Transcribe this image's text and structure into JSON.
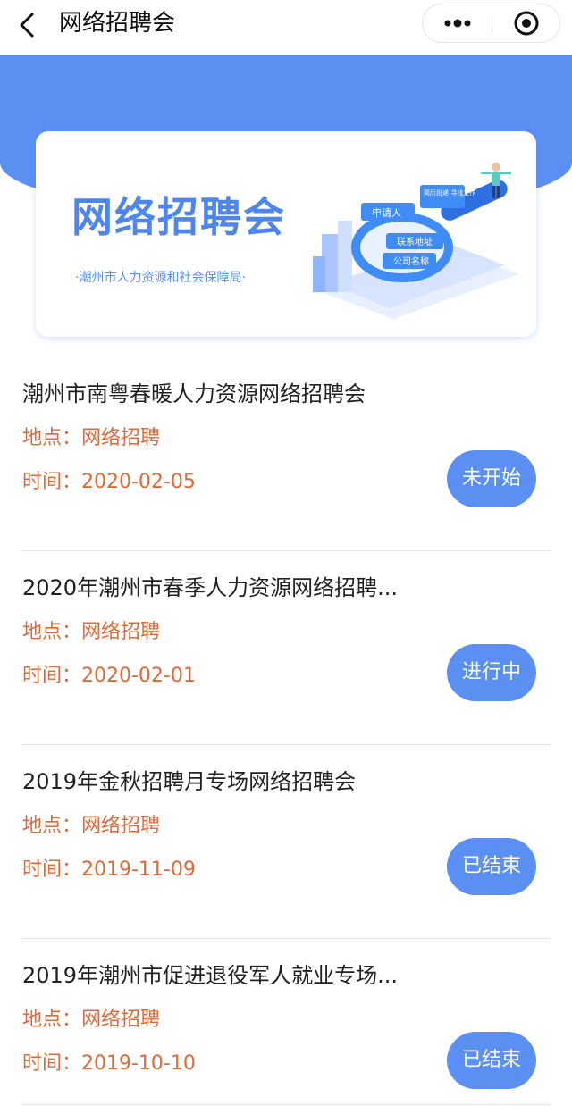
{
  "nav": {
    "title": "网络招聘会",
    "back_icon": "chevron-left-icon",
    "more_icon": "more-dots-icon",
    "close_icon": "target-close-icon"
  },
  "banner": {
    "title": "网络招聘会",
    "subtitle": "·潮州市人力资源和社会保障局·",
    "illustration_labels": [
      "申请人",
      "联系地址",
      "公司名称",
      "简历投递 寻找工作"
    ]
  },
  "labels": {
    "location_prefix": "地点：",
    "time_prefix": "时间："
  },
  "items": [
    {
      "title": "潮州市南粤春暖人力资源网络招聘会",
      "location": "地点：网络招聘",
      "time": "时间：2020-02-05",
      "status": "未开始"
    },
    {
      "title": "2020年潮州市春季人力资源网络招聘...",
      "location": "地点：网络招聘",
      "time": "时间：2020-02-01",
      "status": "进行中"
    },
    {
      "title": "2019年金秋招聘月专场网络招聘会",
      "location": "地点：网络招聘",
      "time": "时间：2019-11-09",
      "status": "已结束"
    },
    {
      "title": "2019年潮州市促进退役军人就业专场...",
      "location": "地点：网络招聘",
      "time": "时间：2019-10-10",
      "status": "已结束"
    }
  ],
  "colors": {
    "accent": "#5b8ff2",
    "meta_text": "#dd6a3a",
    "divider": "#e5e5e5"
  }
}
